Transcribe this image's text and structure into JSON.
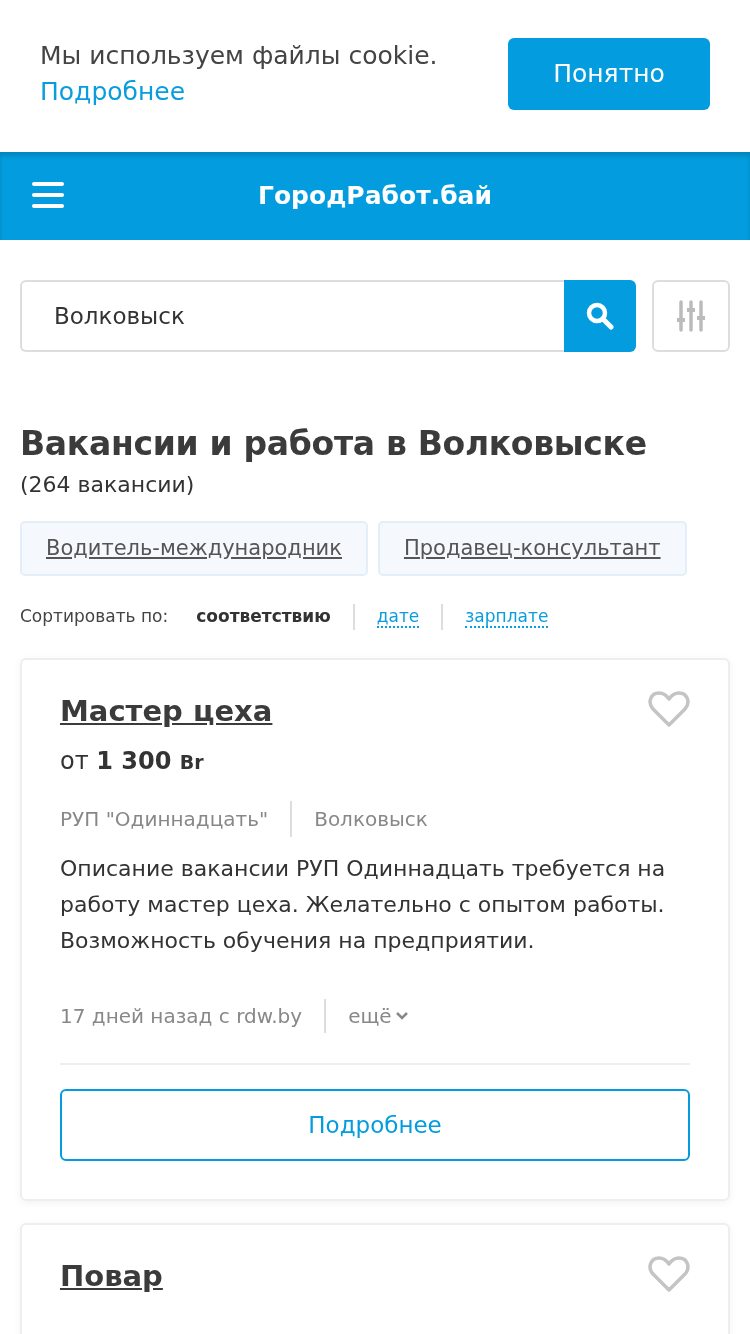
{
  "cookie_banner": {
    "text": "Мы используем файлы cookie.",
    "link": "Подробнее",
    "button": "Понятно"
  },
  "header": {
    "title": "ГородРабот.бай"
  },
  "search": {
    "value": "Волковыск"
  },
  "heading": "Вакансии и работа в Волковыске",
  "count": "(264 вакансии)",
  "tags": [
    "Водитель-международник",
    "Продавец-консультант"
  ],
  "sort": {
    "label": "Сортировать по:",
    "options": [
      {
        "label": "соответствию",
        "selected": true
      },
      {
        "label": "дате",
        "selected": false
      },
      {
        "label": "зарплате",
        "selected": false
      }
    ]
  },
  "vacancies": [
    {
      "title": "Мастер цеха",
      "salary_prefix": "от",
      "salary_amount": "1 300",
      "salary_currency": "Br",
      "favorite": false,
      "company": "РУП \"Одиннадцать\"",
      "city": "Волковыск",
      "description": "Описание вакансии РУП Одиннадцать требуется на работу мастер цеха. Желательно с опытом работы. Возможность обучения на предприятии.",
      "age": "17 дней назад с",
      "source": "rdw.by",
      "more": "ещё",
      "button": "Подробнее"
    },
    {
      "title": "Повар",
      "favorite": false
    }
  ]
}
